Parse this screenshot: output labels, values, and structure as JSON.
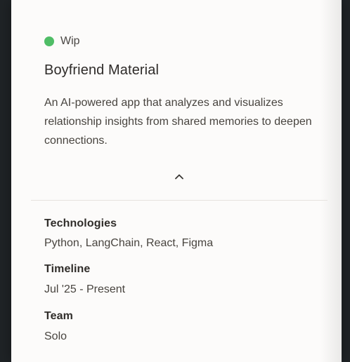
{
  "card": {
    "status": {
      "label": "Wip",
      "color": "#4fbd66"
    },
    "title": "Boyfriend Material",
    "description": "An AI-powered app that analyzes and visualizes relationship insights from shared memories to deepen connections.",
    "collapse_icon": "chevron-up-icon",
    "details": {
      "technologies": {
        "label": "Technologies",
        "value": "Python, LangChain, React, Figma"
      },
      "timeline": {
        "label": "Timeline",
        "value": "Jul '25 - Present"
      },
      "team": {
        "label": "Team",
        "value": "Solo"
      }
    }
  }
}
